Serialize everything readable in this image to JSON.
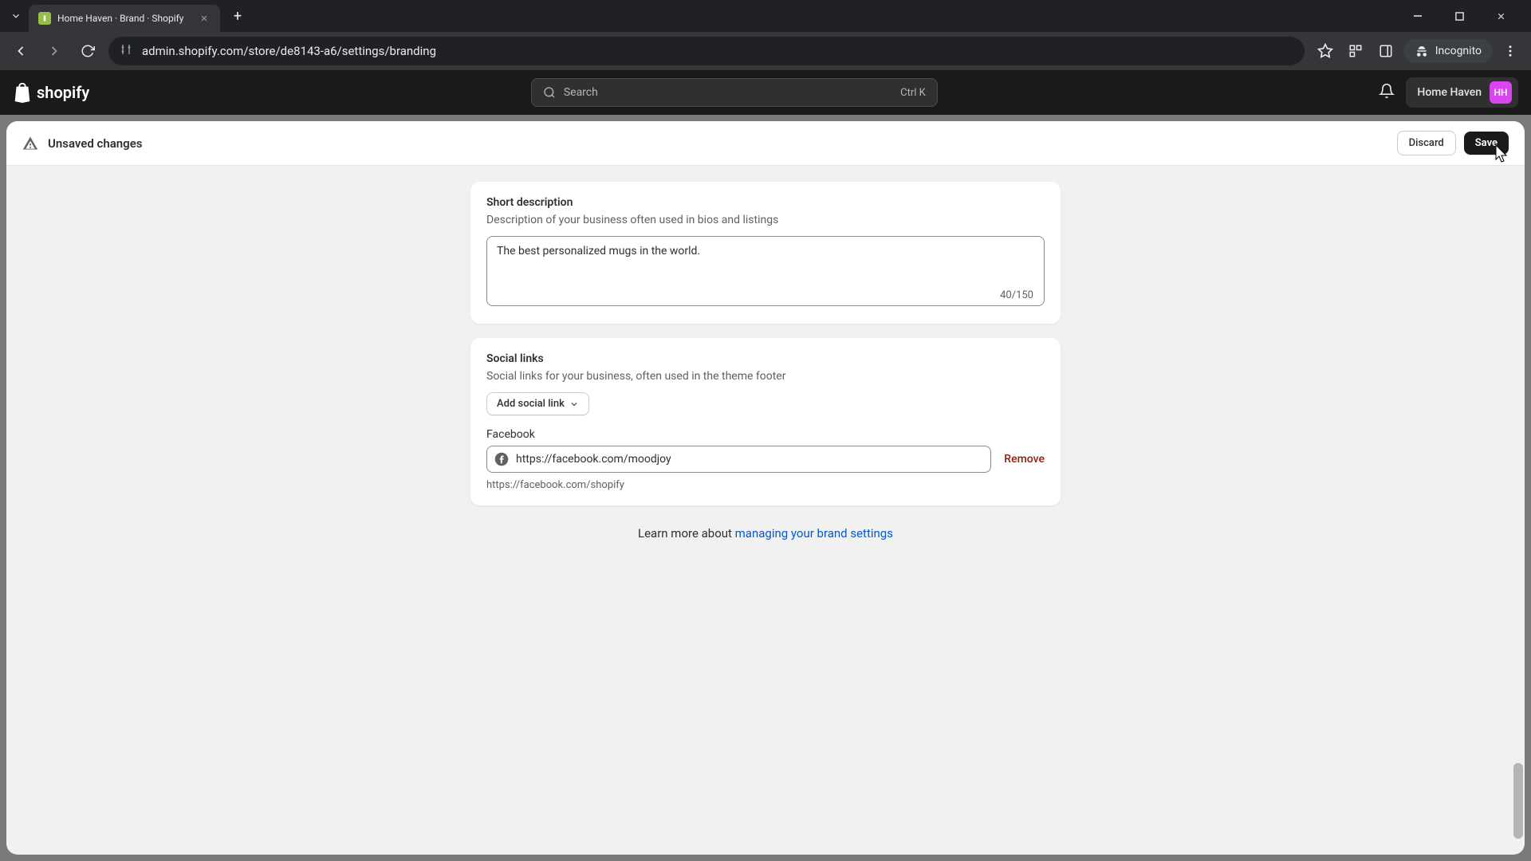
{
  "browser": {
    "tab_title": "Home Haven · Brand · Shopify",
    "url": "admin.shopify.com/store/de8143-a6/settings/branding",
    "incognito_label": "Incognito"
  },
  "topbar": {
    "logo_text": "shopify",
    "search_placeholder": "Search",
    "search_shortcut": "Ctrl K",
    "store_name": "Home Haven",
    "avatar_initials": "HH"
  },
  "banner": {
    "unsaved_text": "Unsaved changes",
    "discard_label": "Discard",
    "save_label": "Save"
  },
  "short_desc": {
    "title": "Short description",
    "subtitle": "Description of your business often used in bios and listings",
    "value": "The best personalized mugs in the world.",
    "counter": "40/150"
  },
  "social": {
    "title": "Social links",
    "subtitle": "Social links for your business, often used in the theme footer",
    "add_button_label": "Add social link",
    "items": [
      {
        "platform": "Facebook",
        "url": "https://facebook.com/moodjoy",
        "hint": "https://facebook.com/shopify",
        "remove_label": "Remove"
      }
    ]
  },
  "footer_help": {
    "prefix": "Learn more about ",
    "link_text": "managing your brand settings"
  }
}
